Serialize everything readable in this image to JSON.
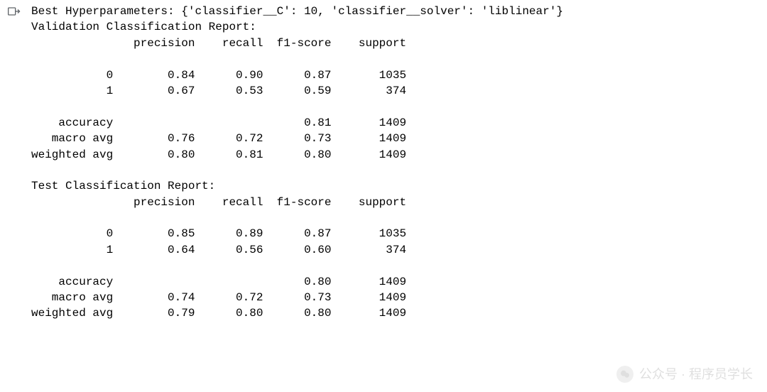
{
  "output": {
    "hyperparams_line": "Best Hyperparameters: {'classifier__C': 10, 'classifier__solver': 'liblinear'}",
    "validation": {
      "title": "Validation Classification Report:",
      "header": {
        "precision": "precision",
        "recall": "recall",
        "f1": "f1-score",
        "support": "support"
      },
      "classes": [
        {
          "label": "0",
          "precision": "0.84",
          "recall": "0.90",
          "f1": "0.87",
          "support": "1035"
        },
        {
          "label": "1",
          "precision": "0.67",
          "recall": "0.53",
          "f1": "0.59",
          "support": "374"
        }
      ],
      "summary": [
        {
          "label": "accuracy",
          "precision": "",
          "recall": "",
          "f1": "0.81",
          "support": "1409"
        },
        {
          "label": "macro avg",
          "precision": "0.76",
          "recall": "0.72",
          "f1": "0.73",
          "support": "1409"
        },
        {
          "label": "weighted avg",
          "precision": "0.80",
          "recall": "0.81",
          "f1": "0.80",
          "support": "1409"
        }
      ]
    },
    "test": {
      "title": "Test Classification Report:",
      "header": {
        "precision": "precision",
        "recall": "recall",
        "f1": "f1-score",
        "support": "support"
      },
      "classes": [
        {
          "label": "0",
          "precision": "0.85",
          "recall": "0.89",
          "f1": "0.87",
          "support": "1035"
        },
        {
          "label": "1",
          "precision": "0.64",
          "recall": "0.56",
          "f1": "0.60",
          "support": "374"
        }
      ],
      "summary": [
        {
          "label": "accuracy",
          "precision": "",
          "recall": "",
          "f1": "0.80",
          "support": "1409"
        },
        {
          "label": "macro avg",
          "precision": "0.74",
          "recall": "0.72",
          "f1": "0.73",
          "support": "1409"
        },
        {
          "label": "weighted avg",
          "precision": "0.79",
          "recall": "0.80",
          "f1": "0.80",
          "support": "1409"
        }
      ]
    }
  },
  "watermark": {
    "text": "公众号 · 程序员学长"
  }
}
